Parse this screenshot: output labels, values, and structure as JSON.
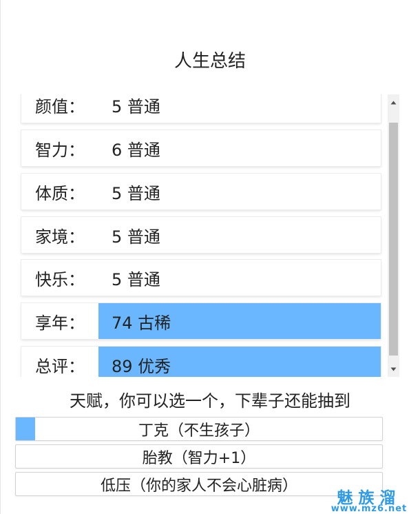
{
  "summary": {
    "title": "人生总结",
    "stats": [
      {
        "label": "颜值：",
        "value": "5 普通",
        "highlight": false
      },
      {
        "label": "智力：",
        "value": "6 普通",
        "highlight": false
      },
      {
        "label": "体质：",
        "value": "5 普通",
        "highlight": false
      },
      {
        "label": "家境：",
        "value": "5 普通",
        "highlight": false
      },
      {
        "label": "快乐：",
        "value": "5 普通",
        "highlight": false
      },
      {
        "label": "享年：",
        "value": "74 古稀",
        "highlight": true
      },
      {
        "label": "总评：",
        "value": "89 优秀",
        "highlight": true
      }
    ]
  },
  "scrollbar": {
    "up_icon": "▲",
    "down_icon": "▼"
  },
  "talents": {
    "heading": "天赋，你可以选一个，下辈子还能抽到",
    "options": [
      {
        "label": "丁克（不生孩子）",
        "selected": true
      },
      {
        "label": "胎教（智力+1）",
        "selected": false
      },
      {
        "label": "低压（你的家人不会心脏病）",
        "selected": false
      }
    ]
  },
  "watermark": {
    "title": "魅族溜",
    "url": "www.mz6.net"
  },
  "colors": {
    "highlight": "#6ab7ff",
    "watermark": "#2f9be6"
  }
}
